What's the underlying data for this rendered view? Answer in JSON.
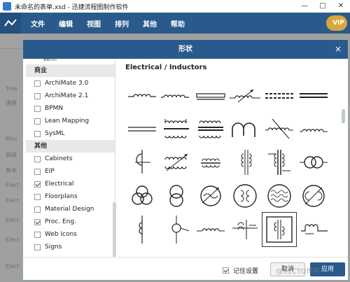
{
  "window": {
    "title": "未命名的表单.xsd - 迅捷流程图制作软件",
    "controls": [
      "—",
      "□",
      "✕"
    ]
  },
  "menubar": {
    "items": [
      "文件",
      "编辑",
      "视图",
      "排列",
      "其他",
      "帮助"
    ],
    "vip_label": "VIP"
  },
  "bg_sidebar": [
    "Tree",
    "通用",
    "Misc",
    "高级",
    "基本",
    "Elect",
    "Elect",
    "Elect",
    "Elect",
    "Elect"
  ],
  "dialog": {
    "title": "形状",
    "close_label": "×",
    "categories": {
      "top_cut": "Venn",
      "group_business": "商业",
      "business_items": [
        {
          "label": "ArchiMate 3.0",
          "checked": false
        },
        {
          "label": "ArchiMate 2.1",
          "checked": false
        },
        {
          "label": "BPMN",
          "checked": false
        },
        {
          "label": "Lean Mapping",
          "checked": false
        },
        {
          "label": "SysML",
          "checked": false
        }
      ],
      "group_other": "其他",
      "other_items": [
        {
          "label": "Cabinets",
          "checked": false
        },
        {
          "label": "EIP",
          "checked": false
        },
        {
          "label": "Electrical",
          "checked": true
        },
        {
          "label": "Floorplans",
          "checked": false
        },
        {
          "label": "Material Design",
          "checked": false
        },
        {
          "label": "Proc. Eng.",
          "checked": true
        },
        {
          "label": "Web Icons",
          "checked": false
        },
        {
          "label": "Signs",
          "checked": false
        }
      ]
    },
    "shapes_title": "Electrical / Inductors",
    "shapes": [
      [
        "inductor-icon",
        "inductor-small-icon",
        "inductor-bracket-icon",
        "variable-inductor-icon",
        "dashed-core-inductor-icon",
        "iron-core-inductor-icon"
      ],
      [
        "double-line-icon",
        "transformer-icon",
        "transformer-core-icon",
        "omega-coil-icon",
        "tapped-coil-icon",
        "air-coil-icon"
      ],
      [
        "coil-winding-icon",
        "variable-transformer-icon",
        "small-transformer-icon",
        "vertical-transformer-icon",
        "transformer-bars-icon",
        "dual-circle-transformer-icon"
      ],
      [
        "triple-circle-icon",
        "overlapping-circles-icon",
        "variable-circle-icon",
        "circle-coupled-icon",
        "circle-mesh-icon",
        "circle-slash-icon"
      ],
      [
        "vertical-coil-icon",
        "circle-arrow-icon",
        "small-coil-icon",
        "cross-coil-icon",
        "boxed-transformer-icon",
        "ground-coil-icon"
      ]
    ],
    "remember_label": "记住设置",
    "remember_checked": true,
    "cancel_label": "取消",
    "apply_label": "应用"
  },
  "watermark": "@51CTO博客",
  "colors": {
    "header_blue": "#2a5a8c",
    "vip_gold": "#d7a63c"
  }
}
